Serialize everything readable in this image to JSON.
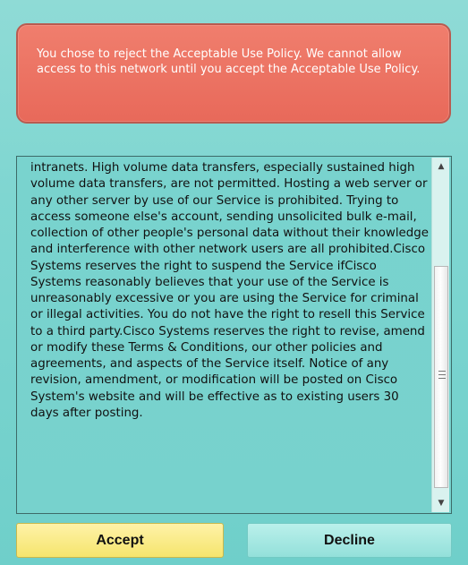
{
  "alert": {
    "message": "You chose to reject the Acceptable Use Policy. We cannot allow access to this network until you accept the Acceptable Use Policy."
  },
  "terms": {
    "text": "intranets. High volume data transfers, especially sustained high volume data transfers, are not permitted. Hosting a web server or any other server by use of our Service is prohibited. Trying to access someone else's account, sending unsolicited bulk e-mail, collection of other people's personal data without their knowledge and interference with other network users are all prohibited.Cisco Systems reserves the right to suspend the Service ifCisco Systems reasonably believes that your use of the Service is unreasonably excessive or you are using the Service for criminal or illegal activities. You do not have the right to resell this Service to a third party.Cisco Systems reserves the right to revise, amend or modify these Terms & Conditions, our other policies and agreements, and aspects of the Service itself. Notice of any revision, amendment, or modification will be posted on Cisco System's website and will be effective as to existing users 30 days after posting.",
    "scroll_icons": {
      "up": "scroll-up-arrow-icon",
      "down": "scroll-down-arrow-icon",
      "grip": "scroll-grip-icon"
    }
  },
  "buttons": {
    "accept_label": "Accept",
    "decline_label": "Decline"
  },
  "colors": {
    "background": "#7fd6d1",
    "alert_background": "#eb6f60",
    "accept_background": "#f7e878",
    "decline_background": "#9fe5df"
  }
}
